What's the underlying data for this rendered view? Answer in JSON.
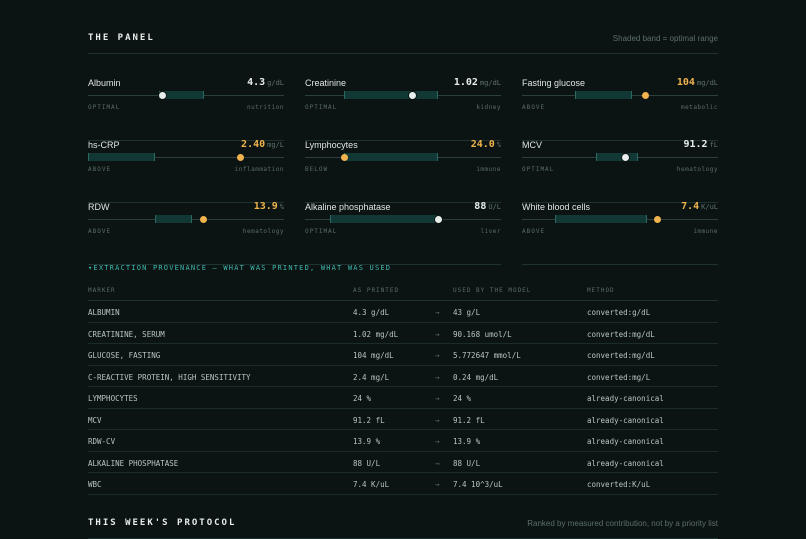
{
  "panel": {
    "title": "THE PANEL",
    "note": "Shaded band = optimal range",
    "markers": [
      {
        "name": "Albumin",
        "value": "4.3",
        "unit": "g/dL",
        "status": "OPTIMAL",
        "system": "nutrition",
        "band": [
          0.36,
          0.58
        ],
        "pos": 0.38
      },
      {
        "name": "Creatinine",
        "value": "1.02",
        "unit": "mg/dL",
        "status": "OPTIMAL",
        "system": "kidney",
        "band": [
          0.2,
          0.67
        ],
        "pos": 0.55
      },
      {
        "name": "Fasting glucose",
        "value": "104",
        "unit": "mg/dL",
        "status": "ABOVE",
        "system": "metabolic",
        "band": [
          0.27,
          0.55
        ],
        "pos": 0.63
      },
      {
        "name": "hs-CRP",
        "value": "2.40",
        "unit": "mg/L",
        "status": "ABOVE",
        "system": "inflammation",
        "band": [
          0.0,
          0.33
        ],
        "pos": 0.78
      },
      {
        "name": "Lymphocytes",
        "value": "24.0",
        "unit": "%",
        "status": "BELOW",
        "system": "immune",
        "band": [
          0.2,
          0.67
        ],
        "pos": 0.2
      },
      {
        "name": "MCV",
        "value": "91.2",
        "unit": "fL",
        "status": "OPTIMAL",
        "system": "hematology",
        "band": [
          0.38,
          0.58
        ],
        "pos": 0.53
      },
      {
        "name": "RDW",
        "value": "13.9",
        "unit": "%",
        "status": "ABOVE",
        "system": "hematology",
        "band": [
          0.34,
          0.52
        ],
        "pos": 0.59
      },
      {
        "name": "Alkaline phosphatase",
        "value": "88",
        "unit": "U/L",
        "status": "OPTIMAL",
        "system": "liver",
        "band": [
          0.13,
          0.68
        ],
        "pos": 0.68
      },
      {
        "name": "White blood cells",
        "value": "7.4",
        "unit": "K/uL",
        "status": "ABOVE",
        "system": "immune",
        "band": [
          0.17,
          0.63
        ],
        "pos": 0.69
      }
    ]
  },
  "provenance": {
    "toggle": "▾EXTRACTION PROVENANCE — WHAT WAS PRINTED, WHAT WAS USED",
    "headers": {
      "marker": "MARKER",
      "printed": "AS PRINTED",
      "used": "USED BY THE MODEL",
      "method": "METHOD"
    },
    "arrow": "→",
    "rows": [
      {
        "marker": "ALBUMIN",
        "printed": "4.3 g/dL",
        "used": "43 g/L",
        "method": "converted:g/dL"
      },
      {
        "marker": "CREATININE, SERUM",
        "printed": "1.02 mg/dL",
        "used": "90.168 umol/L",
        "method": "converted:mg/dL"
      },
      {
        "marker": "GLUCOSE, FASTING",
        "printed": "104 mg/dL",
        "used": "5.772647 mmol/L",
        "method": "converted:mg/dL"
      },
      {
        "marker": "C-REACTIVE PROTEIN, HIGH SENSITIVITY",
        "printed": "2.4 mg/L",
        "used": "0.24 mg/dL",
        "method": "converted:mg/L"
      },
      {
        "marker": "LYMPHOCYTES",
        "printed": "24 %",
        "used": "24 %",
        "method": "already-canonical"
      },
      {
        "marker": "MCV",
        "printed": "91.2 fL",
        "used": "91.2 fL",
        "method": "already-canonical"
      },
      {
        "marker": "RDW-CV",
        "printed": "13.9 %",
        "used": "13.9 %",
        "method": "already-canonical"
      },
      {
        "marker": "ALKALINE PHOSPHATASE",
        "printed": "88 U/L",
        "used": "88 U/L",
        "method": "already-canonical"
      },
      {
        "marker": "WBC",
        "printed": "7.4 K/uL",
        "used": "7.4 10^3/uL",
        "method": "converted:K/uL"
      }
    ]
  },
  "protocol": {
    "title": "THIS WEEK'S PROTOCOL",
    "note": "Ranked by measured contribution, not by a priority list"
  },
  "colors": {
    "accent": "#3fb8ad",
    "warn": "#f0b34d",
    "band": "#123836",
    "bg": "#0b1413"
  }
}
